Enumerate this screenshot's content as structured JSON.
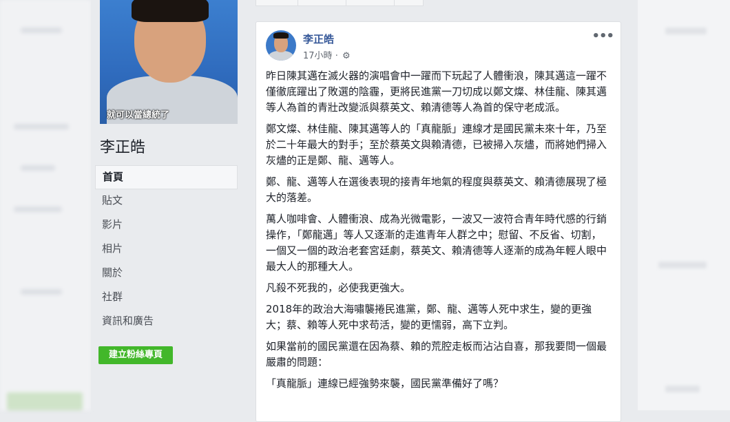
{
  "page": {
    "name": "李正皓",
    "profile_caption": "就可以當總統了"
  },
  "nav": {
    "items": [
      {
        "label": "首頁",
        "active": true
      },
      {
        "label": "貼文",
        "active": false
      },
      {
        "label": "影片",
        "active": false
      },
      {
        "label": "相片",
        "active": false
      },
      {
        "label": "關於",
        "active": false
      },
      {
        "label": "社群",
        "active": false
      },
      {
        "label": "資訊和廣告",
        "active": false
      }
    ],
    "create_button": "建立粉絲專頁"
  },
  "post": {
    "author": "李正皓",
    "time": "17小時",
    "dot": "·",
    "privacy_icon": "gear-icon",
    "more_label": "•••",
    "paragraphs": [
      "昨日陳其邁在滅火器的演唱會中一躍而下玩起了人體衝浪，陳其邁這一躍不僅徹底躍出了敗選的陰霾，更將民進黨一刀切成以鄭文燦、林佳龍、陳其邁等人為首的青壯改變派與蔡英文、賴清德等人為首的保守老成派。",
      "鄭文燦、林佳龍、陳其邁等人的「真龍脈」連線才是國民黨未來十年，乃至於二十年最大的對手；至於蔡英文與賴清德，已被掃入灰燼，而將她們掃入灰燼的正是鄭、龍、邁等人。",
      "鄭、龍、邁等人在選後表現的接青年地氣的程度與蔡英文、賴清德展現了極大的落差。",
      "萬人咖啡會、人體衝浪、成為光微電影，一波又一波符合青年時代感的行銷操作，「鄭龍邁」等人又逐漸的走進青年人群之中；慰留、不反省、切割，一個又一個的政治老套宮廷劇，蔡英文、賴清德等人逐漸的成為年輕人眼中最大人的那種大人。",
      "凡殺不死我的，必使我更強大。",
      "2018年的政治大海嘯襲捲民進黨，鄭、龍、邁等人死中求生，變的更強大；蔡、賴等人死中求苟活，變的更懦弱，高下立判。",
      "如果當前的國民黨還在因為蔡、賴的荒腔走板而沾沾自喜，那我要問一個最嚴肅的問題：",
      "「真龍脈」連線已經強勢來襲，國民黨準備好了嗎？"
    ]
  },
  "colors": {
    "link": "#365899",
    "button_green": "#42b72a",
    "background": "#e9ebee"
  }
}
